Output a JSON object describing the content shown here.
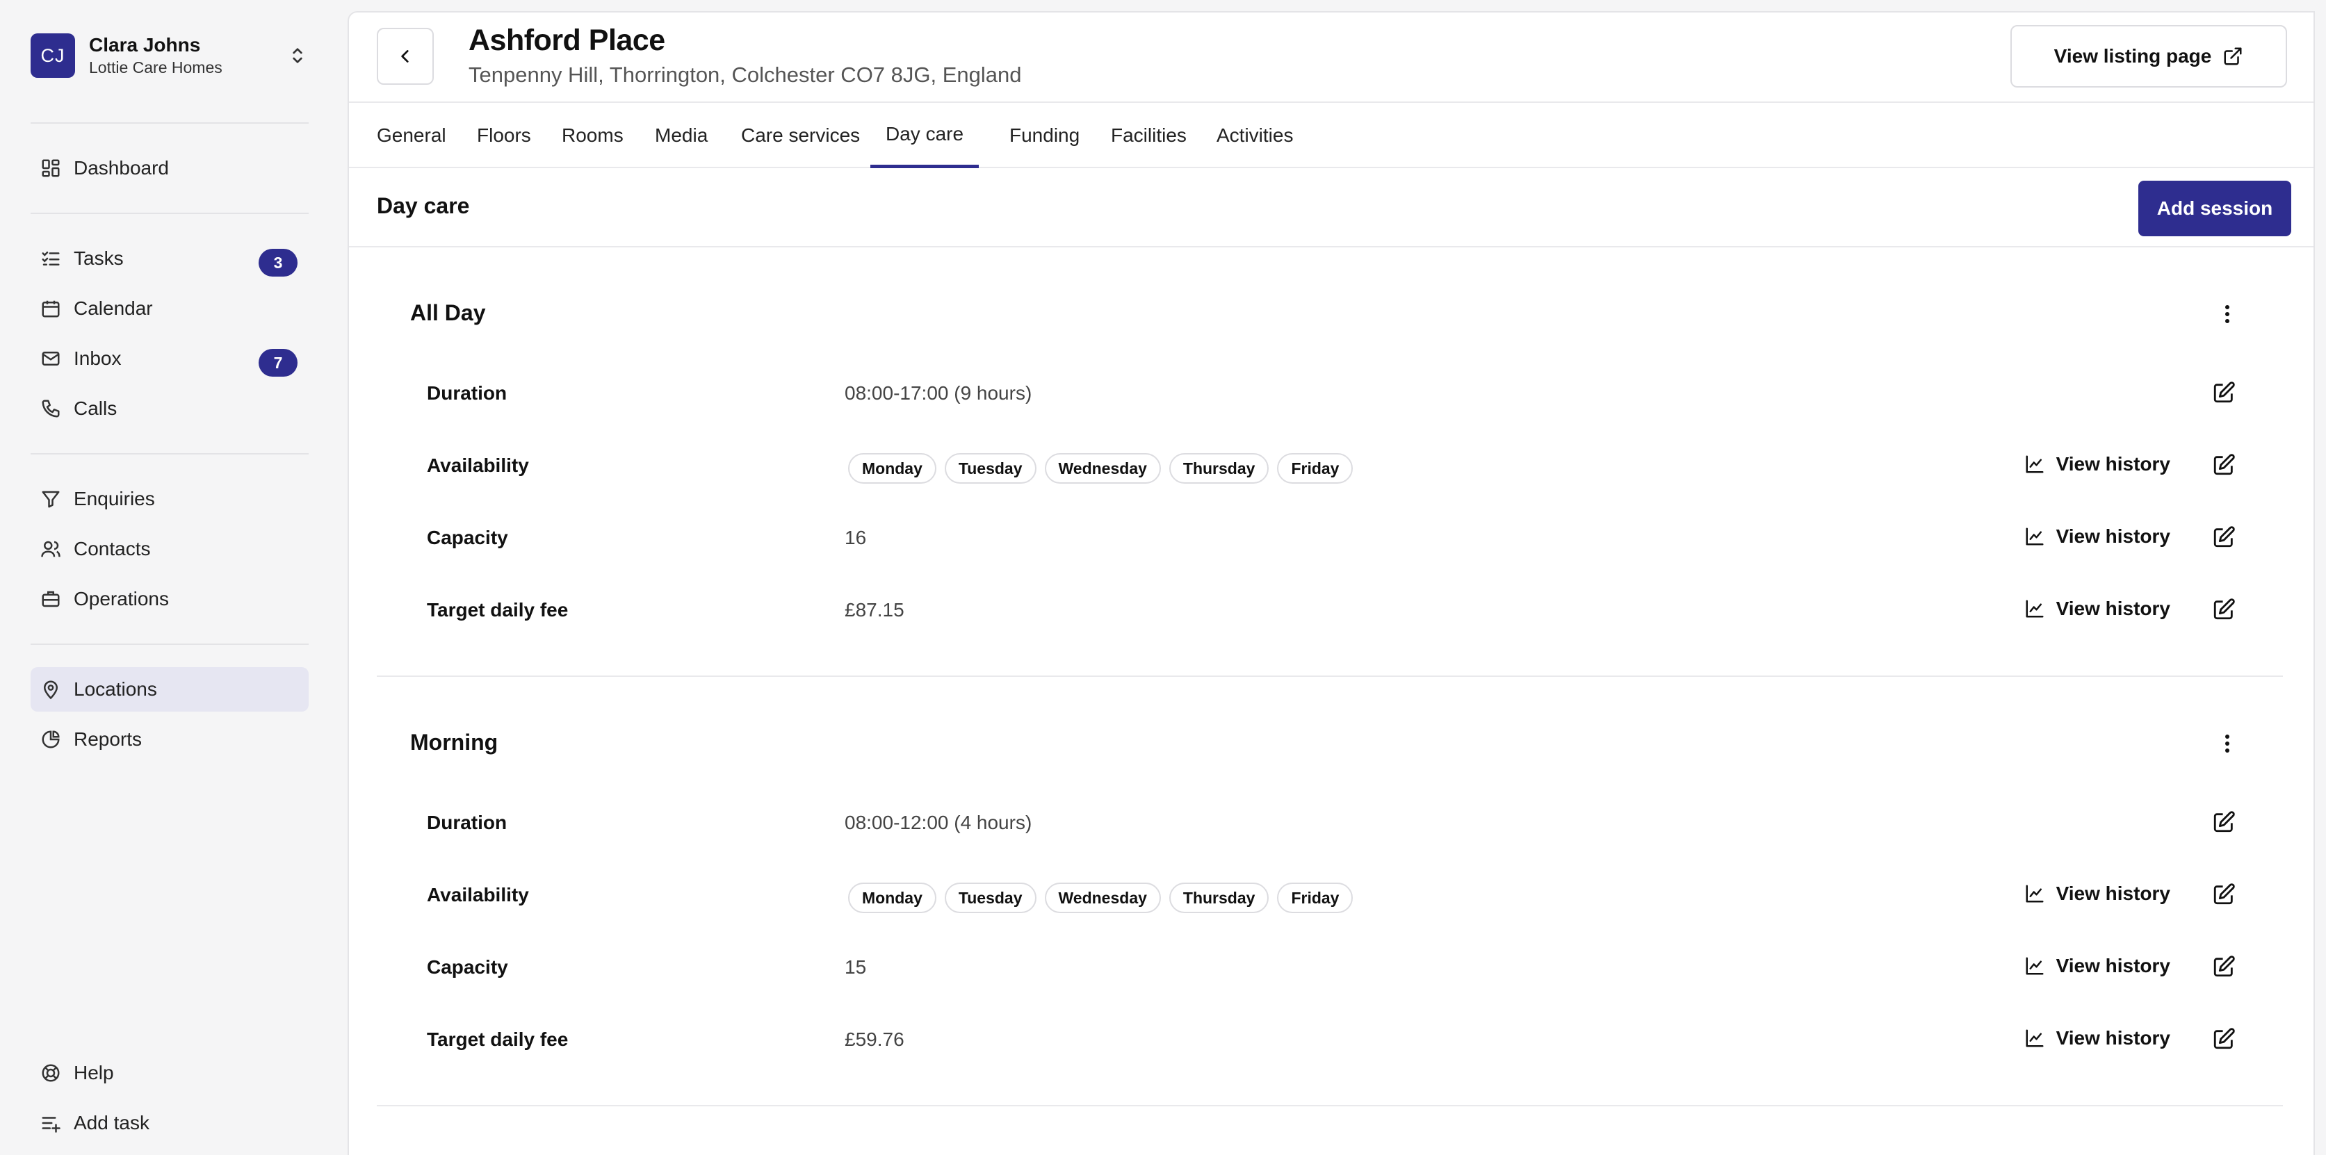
{
  "account": {
    "initials": "CJ",
    "name": "Clara Johns",
    "org": "Lottie Care Homes"
  },
  "nav": {
    "dashboard": "Dashboard",
    "tasks": "Tasks",
    "tasks_count": "3",
    "calendar": "Calendar",
    "inbox": "Inbox",
    "inbox_count": "7",
    "calls": "Calls",
    "enquiries": "Enquiries",
    "contacts": "Contacts",
    "operations": "Operations",
    "locations": "Locations",
    "reports": "Reports",
    "help": "Help",
    "add_task": "Add task"
  },
  "header": {
    "title": "Ashford Place",
    "address": "Tenpenny Hill, Thorrington, Colchester CO7 8JG, England",
    "listing_button": "View listing page"
  },
  "tabs": [
    "General",
    "Floors",
    "Rooms",
    "Media",
    "Care services",
    "Day care",
    "Funding",
    "Facilities",
    "Activities"
  ],
  "active_tab": "Day care",
  "section": {
    "title": "Day care",
    "add_button": "Add session"
  },
  "labels": {
    "duration": "Duration",
    "availability": "Availability",
    "capacity": "Capacity",
    "fee": "Target daily fee",
    "view_history": "View history"
  },
  "sessions": [
    {
      "name": "All Day",
      "duration": "08:00-17:00 (9 hours)",
      "days": [
        "Monday",
        "Tuesday",
        "Wednesday",
        "Thursday",
        "Friday"
      ],
      "capacity": "16",
      "fee": "£87.15"
    },
    {
      "name": "Morning",
      "duration": "08:00-12:00 (4 hours)",
      "days": [
        "Monday",
        "Tuesday",
        "Wednesday",
        "Thursday",
        "Friday"
      ],
      "capacity": "15",
      "fee": "£59.76"
    }
  ],
  "colors": {
    "accent": "#2e2d8f",
    "active_nav_bg": "#e6e6f2"
  }
}
